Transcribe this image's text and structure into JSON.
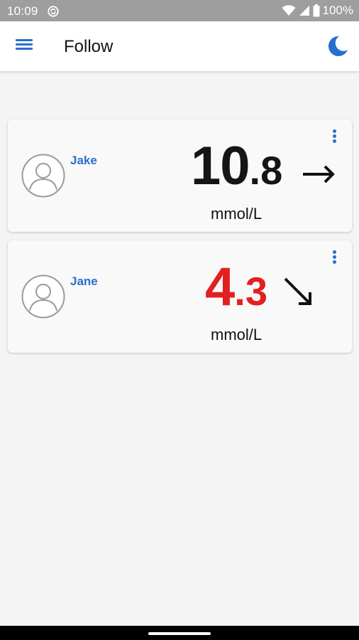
{
  "status_bar": {
    "time": "10:09",
    "battery": "100%",
    "icons": [
      "sync-icon",
      "wifi-icon",
      "signal-icon",
      "battery-icon"
    ]
  },
  "app_bar": {
    "title": "Follow",
    "icons": [
      "menu-icon",
      "moon-icon"
    ]
  },
  "followers": [
    {
      "name": "Jake",
      "value_int": "10",
      "value_dot": ".",
      "value_dec": "8",
      "unit": "mmol/L",
      "trend": "→",
      "trend_icon": "arrow-right-icon",
      "value_color": "#151515"
    },
    {
      "name": "Jane",
      "value_int": "4",
      "value_dot": ".",
      "value_dec": "3",
      "unit": "mmol/L",
      "trend": "↘",
      "trend_icon": "arrow-down-right-icon",
      "value_color": "#e32020"
    }
  ],
  "colors": {
    "accent": "#2a6fcf",
    "low_reading": "#e32020",
    "background": "#f4f4f4"
  }
}
